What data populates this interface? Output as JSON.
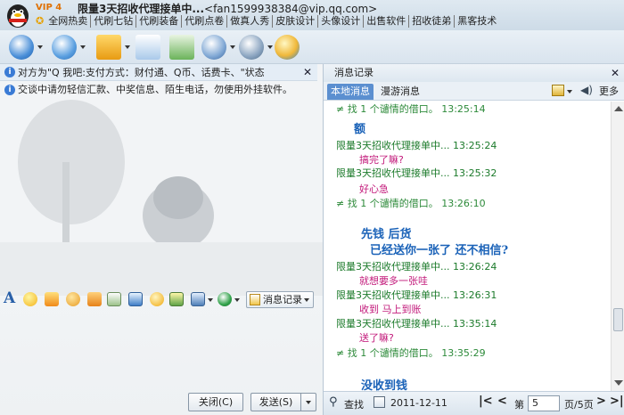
{
  "window": {
    "vip_badge": "VIP 4",
    "title": "限量3天招收代理接单中...",
    "email": "<fan1599938384@vip.qq.com>"
  },
  "menu": [
    "全网热卖",
    "代刷七钻",
    "代刷装备",
    "代刷点卷",
    "做真人秀",
    "皮肤设计",
    "头像设计",
    "出售软件",
    "招收徒弟",
    "黑客技术"
  ],
  "chat": {
    "notice_status": "对方为\"Q 我吧:支付方式：财付通、Q币、话费卡、\"状态",
    "notice_warning": "交谈中请勿轻信汇款、中奖信息、陌生电话，勿使用外挂软件。",
    "msg_record_label": "消息记录",
    "close_label": "关闭(C)",
    "send_label": "发送(S)"
  },
  "history": {
    "title": "消息记录",
    "tabs": [
      "本地消息",
      "漫游消息"
    ],
    "more_label": "更多",
    "messages": [
      {
        "kind": "sys",
        "text": "找 1 个谴情的借口。 13:25:14"
      },
      {
        "kind": "big",
        "text": "额"
      },
      {
        "kind": "meta",
        "text": "限量3天招收代理接单中... 13:25:24"
      },
      {
        "kind": "pink",
        "text": "搞完了嘛?"
      },
      {
        "kind": "meta",
        "text": "限量3天招收代理接单中... 13:25:32"
      },
      {
        "kind": "pink",
        "text": "好心急"
      },
      {
        "kind": "sys",
        "text": "找 1 个谴情的借口。 13:26:10"
      },
      {
        "kind": "big",
        "text": "先钱 后货"
      },
      {
        "kind": "big",
        "text": "已经送你一张了 还不相信?"
      },
      {
        "kind": "meta",
        "text": "限量3天招收代理接单中... 13:26:24"
      },
      {
        "kind": "pink",
        "text": "就想要多一张哇"
      },
      {
        "kind": "meta",
        "text": "限量3天招收代理接单中... 13:26:31"
      },
      {
        "kind": "pink",
        "text": "收到 马上到账"
      },
      {
        "kind": "meta",
        "text": "限量3天招收代理接单中... 13:35:14"
      },
      {
        "kind": "pink",
        "text": "送了嘛?"
      },
      {
        "kind": "sys",
        "text": "找 1 个谴情的借口。 13:35:29"
      },
      {
        "kind": "big",
        "text": "没收到钱"
      }
    ],
    "search_label": "查找",
    "date": "2011-12-11",
    "page_label": "第",
    "page_value": "5",
    "page_total": "页/5页"
  },
  "colors": {
    "accent": "#5b8fd0",
    "name_green": "#1b7a2a",
    "pink": "#c2187a",
    "big_blue": "#1a62b8"
  }
}
